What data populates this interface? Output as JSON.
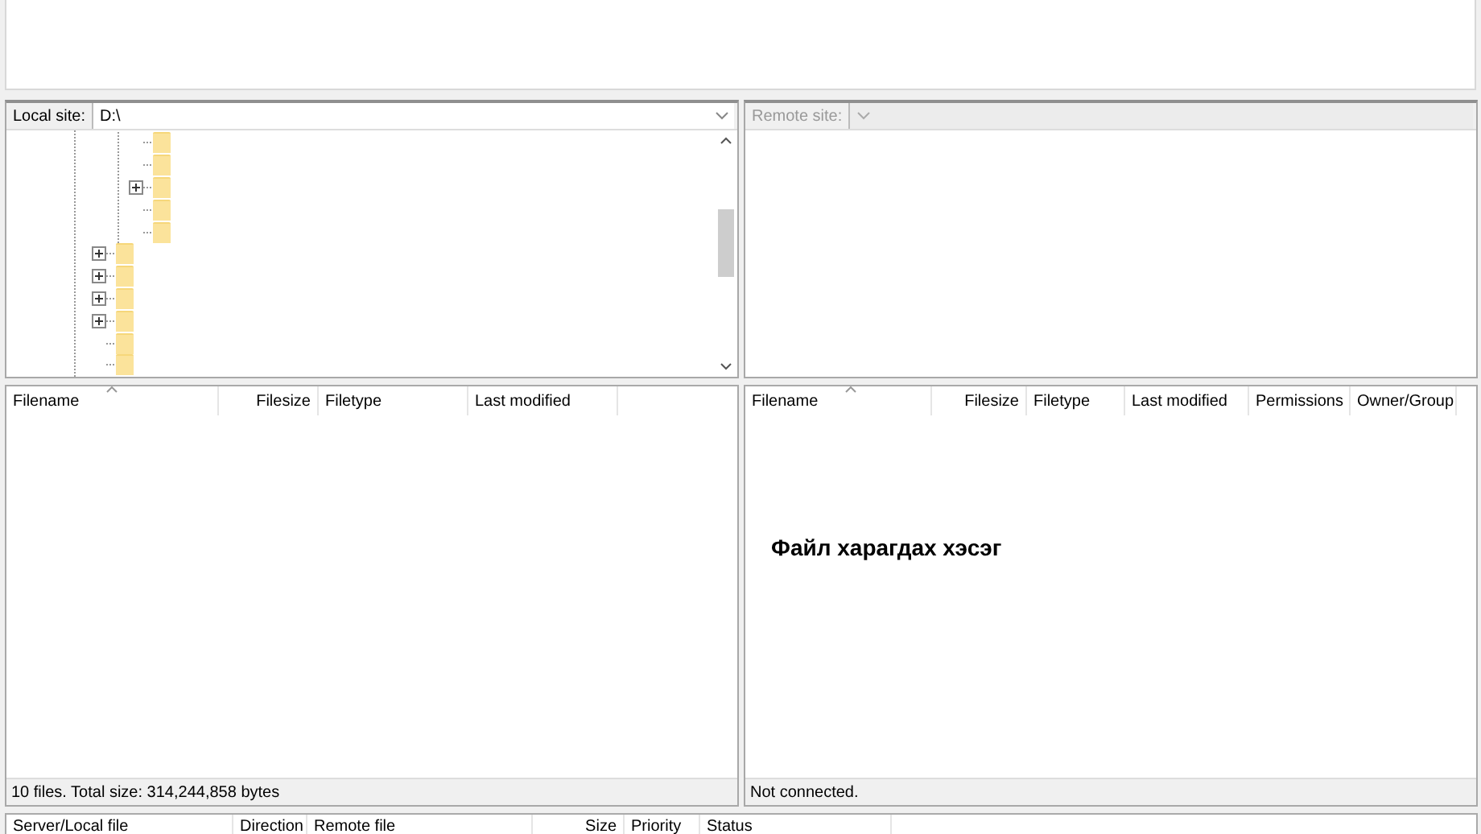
{
  "local_site": {
    "label": "Local site:",
    "value": "D:\\"
  },
  "remote_site": {
    "label": "Remote site:",
    "disabled": true
  },
  "local_tree": [
    {
      "children": [
        {
          "expandable": false
        },
        {
          "expandable": false
        },
        {
          "expandable": true
        },
        {
          "expandable": false
        },
        {
          "expandable": false
        }
      ]
    },
    {
      "expandable": true
    },
    {
      "expandable": true
    },
    {
      "expandable": true
    },
    {
      "expandable": true
    },
    {
      "expandable": false
    },
    {
      "expandable": false
    }
  ],
  "local_list": {
    "columns": [
      {
        "label": "Filename",
        "sorted": true
      },
      {
        "label": "Filesize",
        "sorted": false
      },
      {
        "label": "Filetype",
        "sorted": false
      },
      {
        "label": "Last modified",
        "sorted": false
      }
    ],
    "status": "10 files. Total size: 314,244,858 bytes"
  },
  "remote_list": {
    "columns": [
      {
        "label": "Filename",
        "sorted": true
      },
      {
        "label": "Filesize",
        "sorted": false
      },
      {
        "label": "Filetype",
        "sorted": false
      },
      {
        "label": "Last modified",
        "sorted": false
      },
      {
        "label": "Permissions",
        "sorted": false
      },
      {
        "label": "Owner/Group",
        "sorted": false
      }
    ],
    "caption": "Файл харагдах хэсэг",
    "status": "Not connected."
  },
  "queue": {
    "columns": [
      {
        "label": "Server/Local file"
      },
      {
        "label": "Direction"
      },
      {
        "label": "Remote file"
      },
      {
        "label": "Size"
      },
      {
        "label": "Priority"
      },
      {
        "label": "Status"
      }
    ]
  }
}
